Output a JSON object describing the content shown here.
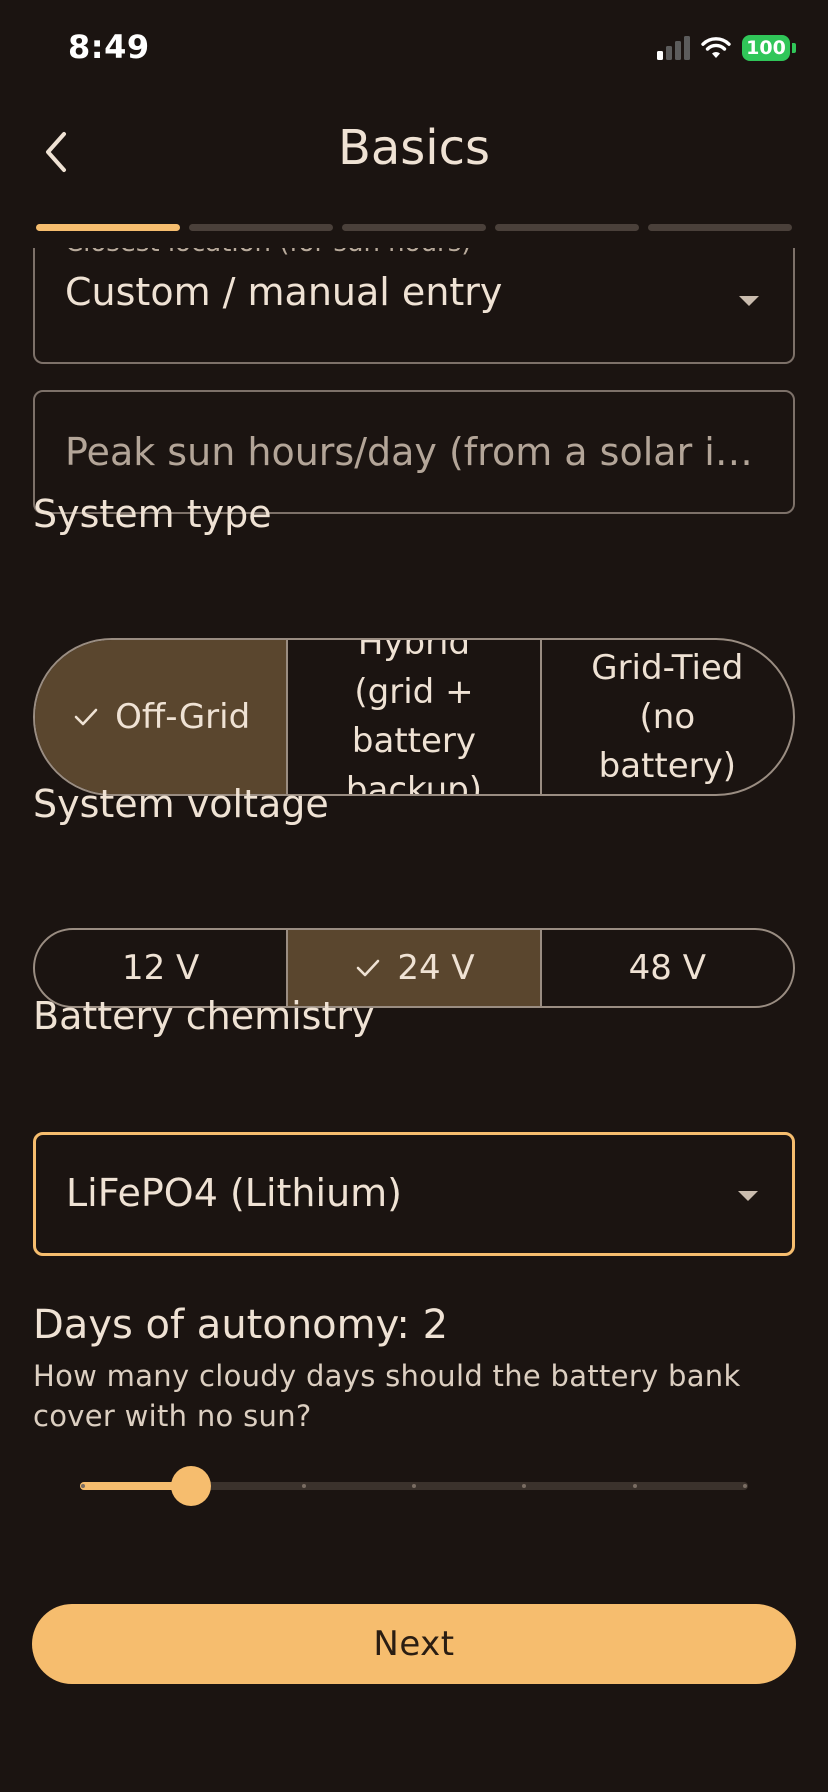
{
  "status_bar": {
    "time": "8:49",
    "battery": "100"
  },
  "header": {
    "title": "Basics",
    "back_icon": "chevron-left-icon"
  },
  "progress": {
    "total_steps": 5,
    "current_step": 1
  },
  "location": {
    "label": "Closest location (for sun hours)",
    "value": "Custom / manual entry"
  },
  "sun_hours": {
    "placeholder": "Peak sun hours/day (from a solar i…",
    "value": ""
  },
  "system_type": {
    "label": "System type",
    "options": [
      {
        "label": "Off-Grid",
        "selected": true
      },
      {
        "label": "Hybrid (grid + battery backup)",
        "selected": false
      },
      {
        "label": "Grid-Tied (no battery)",
        "selected": false
      }
    ]
  },
  "system_voltage": {
    "label": "System voltage",
    "options": [
      {
        "label": "12 V",
        "selected": false
      },
      {
        "label": "24 V",
        "selected": true
      },
      {
        "label": "48 V",
        "selected": false
      }
    ]
  },
  "battery_chemistry": {
    "label": "Battery chemistry",
    "value": "LiFePO4 (Lithium)"
  },
  "autonomy": {
    "label": "Days of autonomy: 2",
    "help": "How many cloudy days should the battery bank cover with no sun?",
    "min": 1,
    "max": 7,
    "value": 2
  },
  "next_button": {
    "label": "Next"
  },
  "colors": {
    "background": "#1b1411",
    "accent": "#f6bd6e",
    "selected_segment": "#5a462e",
    "text": "#efe2d4"
  }
}
